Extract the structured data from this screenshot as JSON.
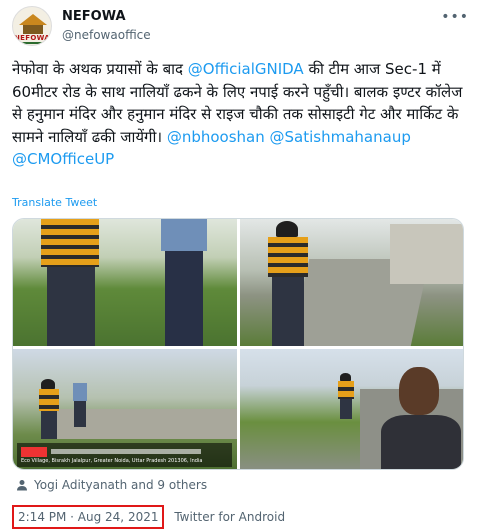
{
  "author": {
    "name": "NEFOWA",
    "handle": "@nefowaoffice",
    "avatar_text": "NEFOWA"
  },
  "tweet": {
    "text_lines": [
      "नेफोवा के अथक प्रयासों के बाद ",
      "@OfficialGNIDA",
      " की टीम आज Sec-1 में 60मीटर रोड के साथ नालियाँ ढकने के लिए नपाई करने पहुँची। बालक इण्टर कॉलेज से हनुमान मंदिर और हनुमान मंदिर से राइज चौकी तक सोसाइटी गेट और मार्किट के सामने नालियाँ ढकी जायेंगी। ",
      "@nbhooshan",
      " ",
      "@Satishmahanaup",
      " ",
      "@CMOfficeUP"
    ],
    "translate_label": "Translate Tweet"
  },
  "media": {
    "caption_overlay": "Eco Village, Bisrakh Jalalpur, Greater Noida, Uttar Pradesh 201306, India"
  },
  "tagged": "Yogi Adityanath and 9 others",
  "meta": {
    "timestamp": "2:14 PM · Aug 24, 2021",
    "separator": "·",
    "source": "Twitter for Android"
  },
  "colors": {
    "link": "#1d9bf0",
    "highlight_box": "#e01818",
    "secondary_text": "#536471"
  }
}
